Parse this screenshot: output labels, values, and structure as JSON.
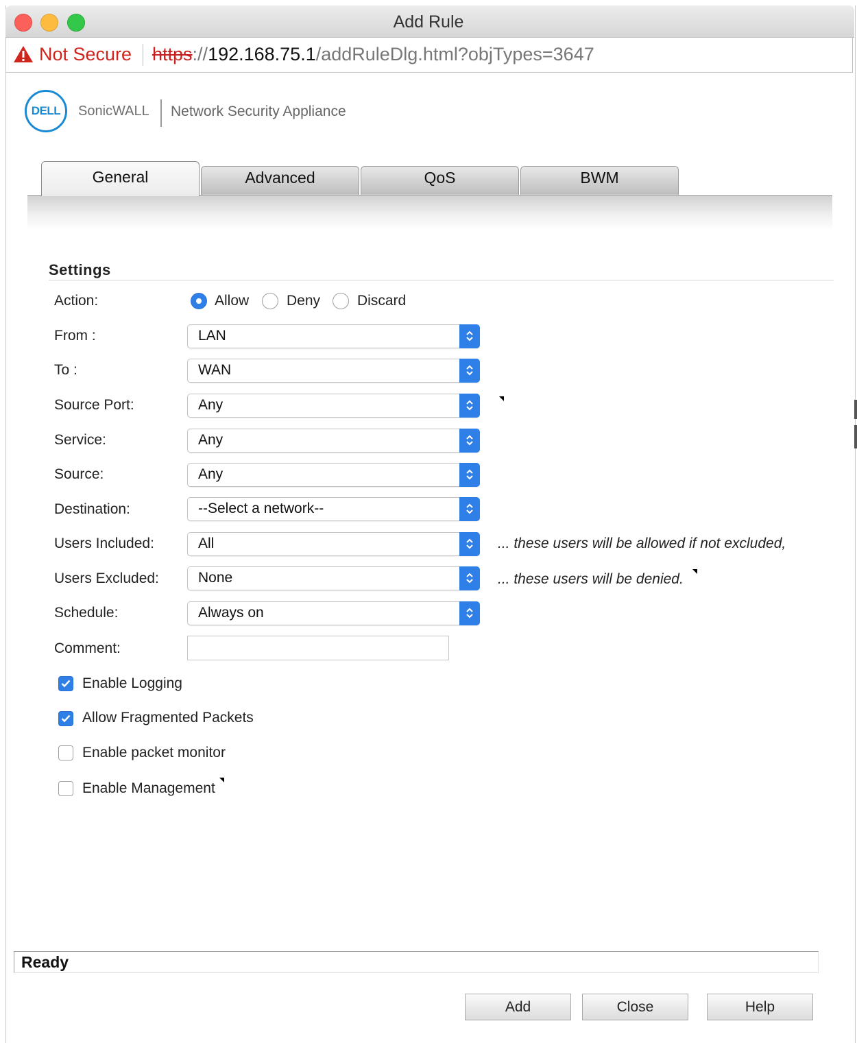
{
  "window": {
    "title": "Add Rule"
  },
  "urlbar": {
    "security_label": "Not Secure",
    "scheme": "https",
    "separator": "://",
    "host": "192.168.75.1",
    "path": "/addRuleDlg.html?objTypes=3647"
  },
  "header": {
    "logo_text": "DELL",
    "brand": "SonicWALL",
    "product": "Network Security Appliance"
  },
  "tabs": [
    {
      "label": "General",
      "active": true
    },
    {
      "label": "Advanced",
      "active": false
    },
    {
      "label": "QoS",
      "active": false
    },
    {
      "label": "BWM",
      "active": false
    }
  ],
  "settings": {
    "title": "Settings",
    "action": {
      "label": "Action:",
      "options": [
        "Allow",
        "Deny",
        "Discard"
      ],
      "selected": "Allow"
    },
    "fields": {
      "from": {
        "label": "From :",
        "value": "LAN"
      },
      "to": {
        "label": "To :",
        "value": "WAN"
      },
      "source_port": {
        "label": "Source Port:",
        "value": "Any"
      },
      "service": {
        "label": "Service:",
        "value": "Any"
      },
      "source": {
        "label": "Source:",
        "value": "Any"
      },
      "destination": {
        "label": "Destination:",
        "value": "--Select a network--"
      },
      "users_included": {
        "label": "Users Included:",
        "value": "All",
        "note": "... these users will be allowed if not excluded,"
      },
      "users_excluded": {
        "label": "Users Excluded:",
        "value": "None",
        "note": "... these users will be denied."
      },
      "schedule": {
        "label": "Schedule:",
        "value": "Always on"
      },
      "comment": {
        "label": "Comment:",
        "value": ""
      }
    },
    "options": {
      "enable_logging": {
        "label": "Enable Logging",
        "checked": true
      },
      "allow_fragmented": {
        "label": "Allow Fragmented Packets",
        "checked": true
      },
      "packet_monitor": {
        "label": "Enable packet monitor",
        "checked": false
      },
      "management": {
        "label": "Enable Management",
        "checked": false
      }
    }
  },
  "status": {
    "text": "Ready"
  },
  "buttons": {
    "add": "Add",
    "close": "Close",
    "help": "Help"
  },
  "colors": {
    "accent": "#2f7fe6",
    "warning": "#d0251d",
    "dell_blue": "#1a8ad4"
  }
}
